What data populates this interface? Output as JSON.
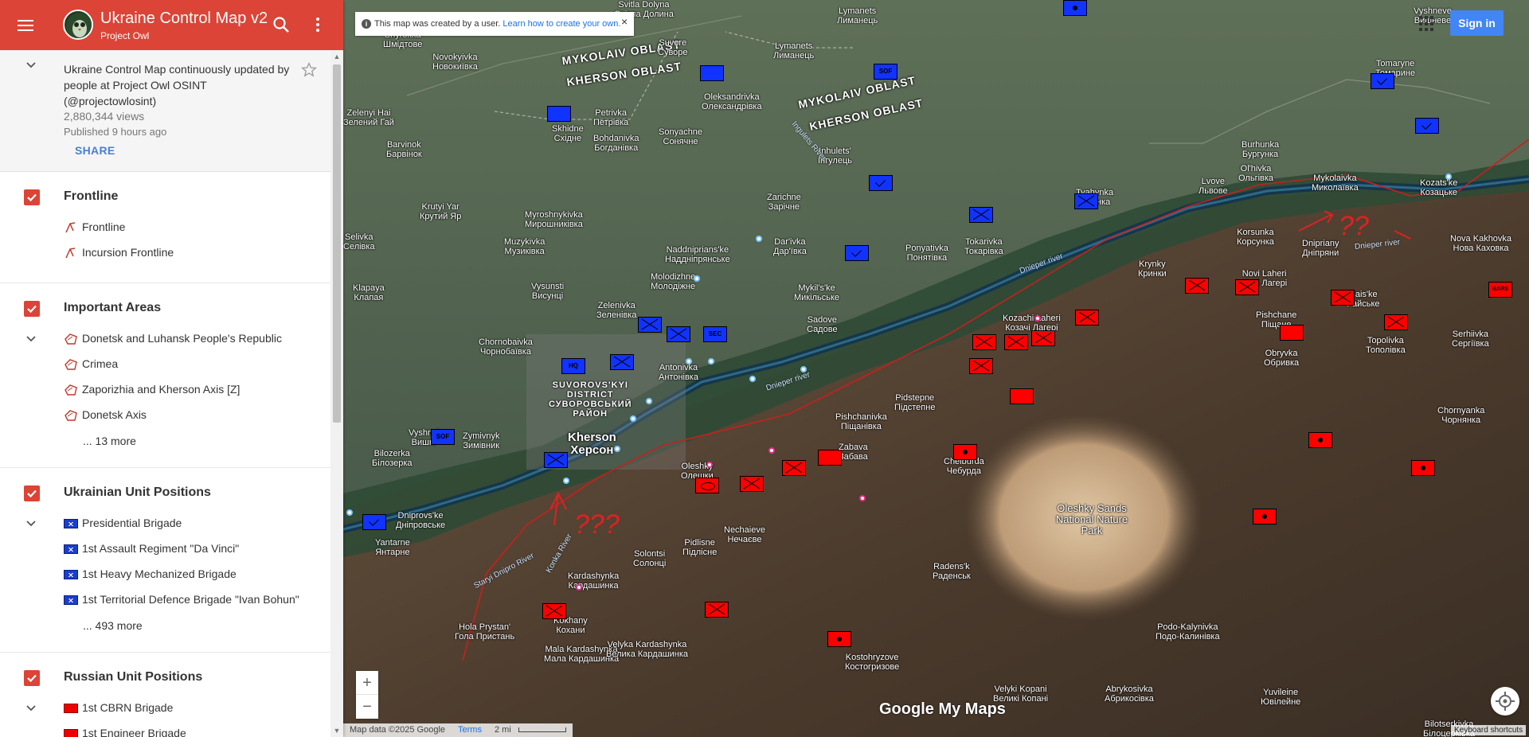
{
  "header": {
    "title": "Ukraine Control Map v2",
    "subtitle": "Project Owl"
  },
  "description": {
    "text": "Ukraine Control Map continuously updated by people at Project Owl OSINT (@projectowlosint)",
    "views": "2,880,344 views",
    "published": "Published 9 hours ago",
    "share_label": "SHARE"
  },
  "layers": [
    {
      "title": "Frontline",
      "items": [
        "Frontline",
        "Incursion Frontline"
      ]
    },
    {
      "title": "Important Areas",
      "items": [
        "Donetsk and Luhansk People's Republic",
        "Crimea",
        "Zaporizhia and Kherson Axis [Z]",
        "Donetsk Axis"
      ],
      "more": "... 13 more"
    },
    {
      "title": "Ukrainian Unit Positions",
      "items": [
        "Presidential Brigade",
        "1st Assault Regiment \"Da Vinci\"",
        "1st Heavy Mechanized Brigade",
        "1st Territorial Defence Brigade \"Ivan Bohun\""
      ],
      "more": "... 493 more"
    },
    {
      "title": "Russian Unit Positions",
      "items": [
        "1st CBRN Brigade",
        "1st Engineer Brigade"
      ]
    }
  ],
  "map": {
    "notice_text": "This map was created by a user.",
    "notice_link": "Learn how to create your own.",
    "signin_label": "Sign in",
    "zoom_in": "+",
    "zoom_out": "−",
    "footer_data": "Map data ©2025 Google",
    "footer_terms": "Terms",
    "footer_scale": "2 mi",
    "keyboard_shortcuts": "Keyboard shortcuts",
    "brand": "Google My Maps",
    "oblasts": [
      "MYKOLAIV OBLAST",
      "KHERSON OBLAST",
      "MYKOLAIV OBLAST",
      "KHERSON OBLAST"
    ],
    "big_cities": [
      "Kherson",
      "Херсон"
    ],
    "districts": [
      "SUVOROVS'KYI",
      "DISTRICT",
      "СУВОРОВСЬКИЙ",
      "РАЙОН"
    ],
    "places": [
      [
        "Svitla Dolyna",
        "Світла Долина"
      ],
      [
        "Suvore",
        "Суворе"
      ],
      [
        "Lymanets",
        "Лиманець"
      ],
      [
        "Lymanets",
        "Лиманець"
      ],
      [
        "Shyrokka",
        "Шмідтове"
      ],
      [
        "Novokyivka",
        "Новокиївка"
      ],
      [
        "Petrivka",
        "Петрівка"
      ],
      [
        "Skhidne",
        "Східне"
      ],
      [
        "Bohdanivka",
        "Богданівка"
      ],
      [
        "Sonyachne",
        "Сонячне"
      ],
      [
        "Oleksandrivka",
        "Олександрівка"
      ],
      [
        "Zelenyi Hai",
        "Зелений Гай"
      ],
      [
        "Barvinok",
        "Барвінок"
      ],
      [
        "Inhulets'",
        "Інгулець"
      ],
      [
        "Zarichne",
        "Зарічне"
      ],
      [
        "Tyahynka",
        "Тягинка"
      ],
      [
        "Krutyi Yar",
        "Крутий Яр"
      ],
      [
        "Myroshnykivka",
        "Мирошниківка"
      ],
      [
        "Muzykivka",
        "Музиківка"
      ],
      [
        "Dar'ivka",
        "Дар'ївка"
      ],
      [
        "Naddniprians'ke",
        "Наддніпрянське"
      ],
      [
        "Ponyativka",
        "Понятівка"
      ],
      [
        "Tokarivka",
        "Токарівка"
      ],
      [
        "Selivka",
        "Селівка"
      ],
      [
        "Klapaya",
        "Клапая"
      ],
      [
        "Vysunsti",
        "Висунці"
      ],
      [
        "Molodizhne",
        "Молодіжне"
      ],
      [
        "Zelenivka",
        "Зеленівка"
      ],
      [
        "Mykil's'ke",
        "Микільське"
      ],
      [
        "Sadove",
        "Садове"
      ],
      [
        "Chornobaivka",
        "Чорнобаївка"
      ],
      [
        "Antonivka",
        "Антонівка"
      ],
      [
        "Pidstepne",
        "Підстепне"
      ],
      [
        "Kozachi Laheri",
        "Козачі Лагері"
      ],
      [
        "Krynky",
        "Кринки"
      ],
      [
        "Korsunka",
        "Корсунка"
      ],
      [
        "Dnipriany",
        "Дніпряни"
      ],
      [
        "Nova Kakhovka",
        "Нова Каховка"
      ],
      [
        "Novi Laheri",
        "Нові Лагері"
      ],
      [
        "Pishchane",
        "Піщане"
      ],
      [
        "Rais'ke",
        "Райське"
      ],
      [
        "Obryvka",
        "Обривка"
      ],
      [
        "Topolivka",
        "Тополівка"
      ],
      [
        "Serhiivka",
        "Сергіївка"
      ],
      [
        "Chornyanka",
        "Чорнянка"
      ],
      [
        "Mykolaivka",
        "Миколаївка"
      ],
      [
        "Lvove",
        "Львове"
      ],
      [
        "Ol'hivka",
        "Ольгівка"
      ],
      [
        "Burhunka",
        "Бургунка"
      ],
      [
        "Kozats'ke",
        "Козацьке"
      ],
      [
        "Vyshneve",
        "Вишневе"
      ],
      [
        "Tomaryne",
        "Томарине"
      ],
      [
        "Vyshnyi",
        "Вишні"
      ],
      [
        "Zymivnyk",
        "Зимівник"
      ],
      [
        "Bilozerka",
        "Білозерка"
      ],
      [
        "Dniprovs'ke",
        "Дніпровське"
      ],
      [
        "Yantarne",
        "Янтарне"
      ],
      [
        "Oleshky",
        "Олешки"
      ],
      [
        "Pishchanivka",
        "Піщанівка"
      ],
      [
        "Zabava",
        "Забава"
      ],
      [
        "Chelburda",
        "Чебурда"
      ],
      [
        "Nechaieve",
        "Нечаєве"
      ],
      [
        "Pidlisne",
        "Підлісне"
      ],
      [
        "Solontsi",
        "Солонці"
      ],
      [
        "Kardashynka",
        "Кардашинка"
      ],
      [
        "Hola Prystan'",
        "Гола Пристань"
      ],
      [
        "Kokhany",
        "Кохани"
      ],
      [
        "Mala Kardashynka",
        "Мала Кардашинка"
      ],
      [
        "Velyka Kardashynka",
        "Велика Кардашинка"
      ],
      [
        "Kostohryzove",
        "Костогризове"
      ],
      [
        "Radens'k",
        "Раденськ"
      ],
      [
        "Podo-Kalynivka",
        "Подо-Калинівка"
      ],
      [
        "Velyki Kopani",
        "Великі Копані"
      ],
      [
        "Abrykosivka",
        "Абрикосівка"
      ],
      [
        "Yuvileine",
        "Ювілейне"
      ],
      [
        "Bilotserkivka",
        "Білоцерківка"
      ]
    ],
    "nature_park": "Oleshky Sands National Nature Park",
    "rivers": [
      "Dnieper river",
      "Dnieper river",
      "Dnieper river",
      "Staryi Dnipro River",
      "Konka River",
      "Ingulets River"
    ]
  },
  "colors": {
    "header_bg": "#db4437",
    "checkbox": "#db4437",
    "ua_unit": "#1133ff",
    "ru_unit": "#ff0000",
    "link": "#4a7fd4"
  }
}
